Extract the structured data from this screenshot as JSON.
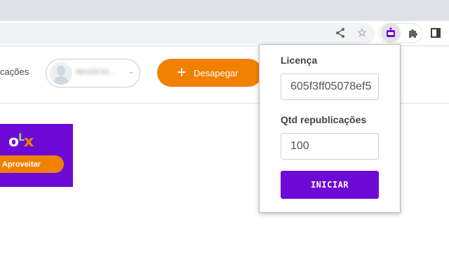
{
  "header": {
    "nav_partial": "cações",
    "user_name": "NEGÓCIO...",
    "desapegar_label": "Desapegar"
  },
  "banner": {
    "logo": "OLX",
    "button_label": "Aproveitar"
  },
  "popup": {
    "license_label": "Licença",
    "license_value": "605f3ff05078ef5",
    "qty_label": "Qtd republicações",
    "qty_value": "100",
    "start_label": "INICIAR"
  },
  "colors": {
    "brand_purple": "#6e0ad6",
    "brand_orange": "#f28000"
  }
}
